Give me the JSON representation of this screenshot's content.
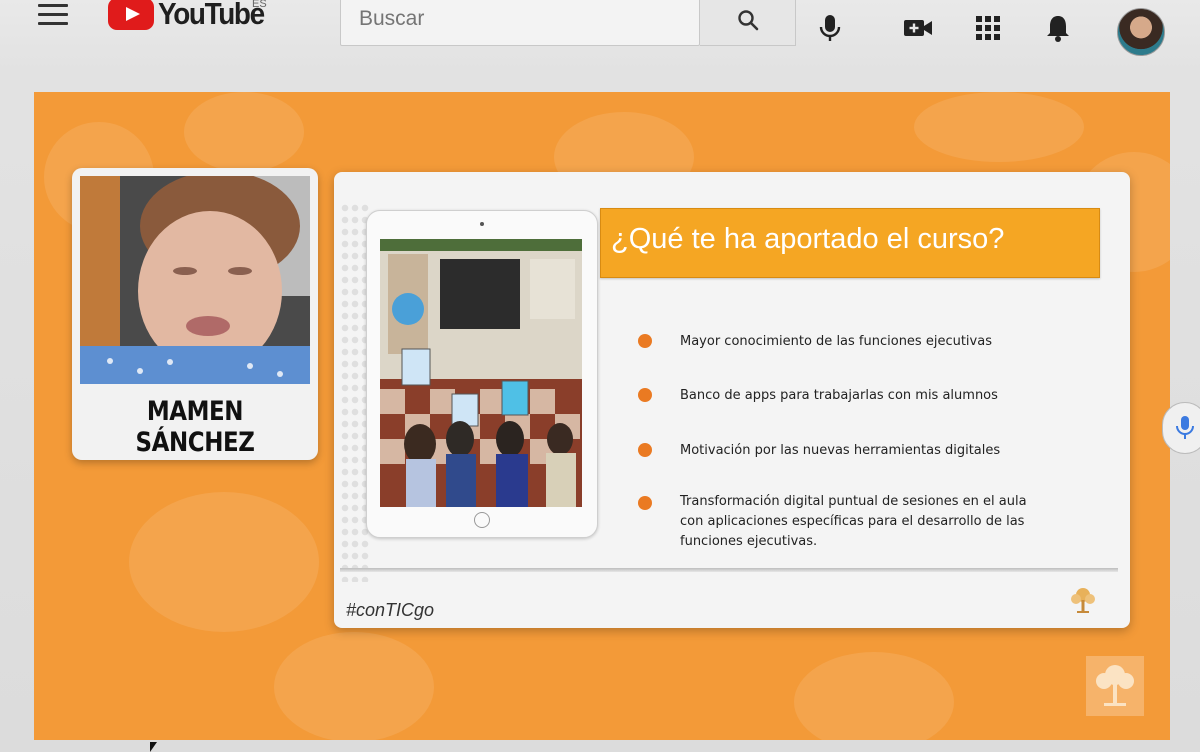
{
  "header": {
    "logo_text": "YouTube",
    "region_code": "ES",
    "search_placeholder": "Buscar",
    "icons": [
      "menu-icon",
      "search-icon",
      "mic-icon",
      "create-video-icon",
      "apps-grid-icon",
      "notifications-bell-icon",
      "avatar"
    ]
  },
  "video": {
    "presenter_name": "MAMEN SÁNCHEZ",
    "slide": {
      "title": "¿Qué te ha aportado el curso?",
      "bullets": [
        "Mayor conocimiento de las funciones ejecutivas",
        "Banco de apps para trabajarlas con mis alumnos",
        "Motivación por las nuevas herramientas digitales",
        "Transformación digital puntual de sesiones en el aula con aplicaciones específicas para el desarrollo de las funciones ejecutivas."
      ],
      "hashtag": "#conTICgo"
    }
  },
  "colors": {
    "video_background": "#f39a38",
    "title_bar": "#f5a623",
    "bullet": "#ea7a22",
    "youtube_red": "#e01b1b"
  }
}
